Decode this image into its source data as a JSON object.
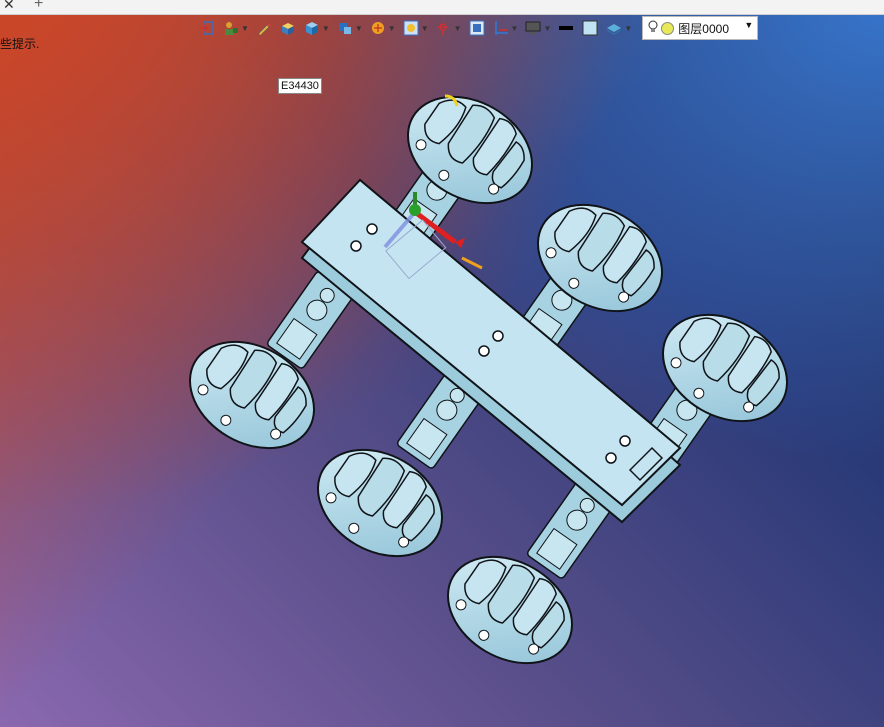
{
  "tabbar": {
    "close_glyph": "✕",
    "add_glyph": "+"
  },
  "hint": {
    "text": "些提示."
  },
  "toolbar": {
    "icons": [
      "exit-icon",
      "user-tools-icon",
      "pen-icon",
      "box-icon",
      "cube-icon",
      "solid-view-icon",
      "render-sun-icon",
      "zoom-view-icon",
      "cross-section-icon",
      "frame-icon",
      "grid-icon",
      "display-icon",
      "line-color-icon",
      "fill-color-icon",
      "layer-stack-icon"
    ],
    "layer": {
      "name": "图层0000",
      "color": "#e8e85a"
    }
  },
  "entity": {
    "label": "E34430"
  },
  "model": {
    "plate_color": "#b8dbe6",
    "wheel_color": "#a9d4e3",
    "outline_color": "#101418"
  }
}
